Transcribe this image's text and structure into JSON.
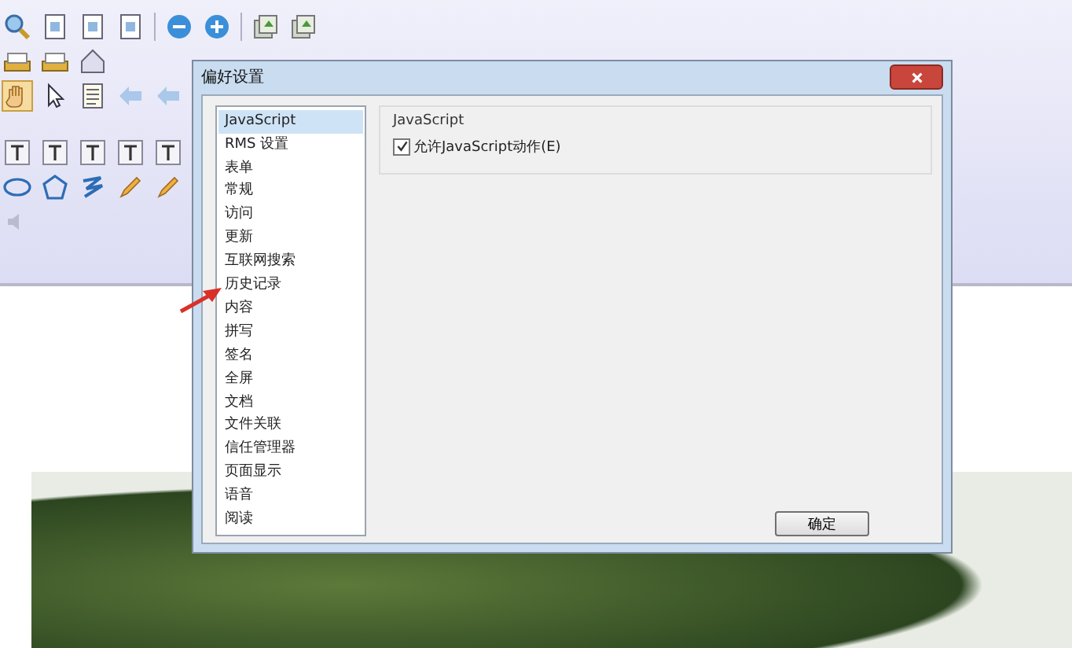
{
  "dialog": {
    "title": "偏好设置",
    "categories": [
      {
        "label": "JavaScript",
        "selected": true
      },
      {
        "label": "RMS 设置",
        "selected": false
      },
      {
        "label": "表单",
        "selected": false
      },
      {
        "label": "常规",
        "selected": false
      },
      {
        "label": "访问",
        "selected": false
      },
      {
        "label": "更新",
        "selected": false
      },
      {
        "label": "互联网搜索",
        "selected": false
      },
      {
        "label": "历史记录",
        "selected": false
      },
      {
        "label": "内容",
        "selected": false
      },
      {
        "label": "拼写",
        "selected": false
      },
      {
        "label": "签名",
        "selected": false
      },
      {
        "label": "全屏",
        "selected": false
      },
      {
        "label": "文档",
        "selected": false
      },
      {
        "label": "文件关联",
        "selected": false
      },
      {
        "label": "信任管理器",
        "selected": false
      },
      {
        "label": "页面显示",
        "selected": false
      },
      {
        "label": "语音",
        "selected": false
      },
      {
        "label": "阅读",
        "selected": false
      }
    ],
    "group_title": "JavaScript",
    "options": [
      {
        "label": "允许JavaScript动作(E)",
        "checked": true
      }
    ],
    "buttons": [
      "确定"
    ]
  }
}
